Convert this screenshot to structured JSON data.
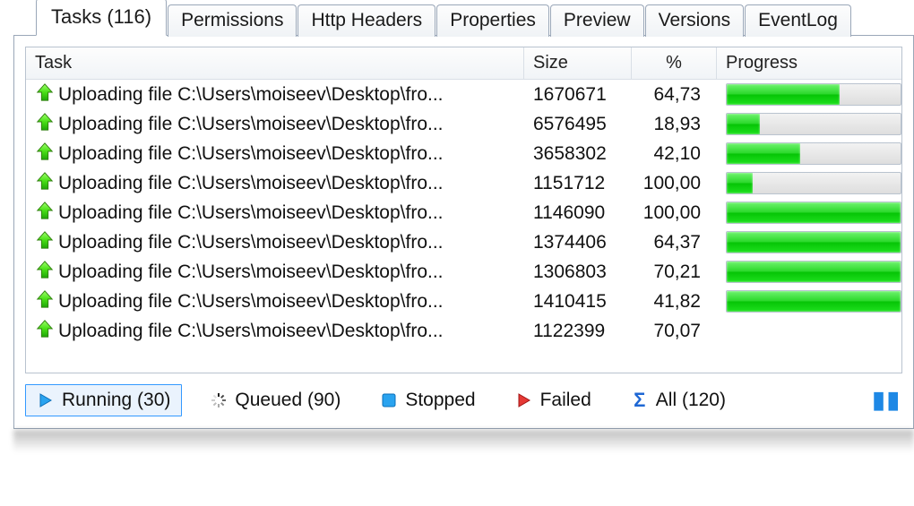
{
  "tabs": [
    {
      "key": "tasks",
      "label": "Tasks (116)",
      "active": true
    },
    {
      "key": "permissions",
      "label": "Permissions",
      "active": false
    },
    {
      "key": "http-headers",
      "label": "Http Headers",
      "active": false
    },
    {
      "key": "properties",
      "label": "Properties",
      "active": false
    },
    {
      "key": "preview",
      "label": "Preview",
      "active": false
    },
    {
      "key": "versions",
      "label": "Versions",
      "active": false
    },
    {
      "key": "eventlog",
      "label": "EventLog",
      "active": false
    }
  ],
  "columns": {
    "task": "Task",
    "size": "Size",
    "percent": "%",
    "progress": "Progress"
  },
  "rows": [
    {
      "task": "Uploading file C:\\Users\\moiseev\\Desktop\\fro...",
      "size": "1670671",
      "pct": "64,73",
      "progress": 64.73
    },
    {
      "task": "Uploading file C:\\Users\\moiseev\\Desktop\\fro...",
      "size": "6576495",
      "pct": "18,93",
      "progress": 18.93
    },
    {
      "task": "Uploading file C:\\Users\\moiseev\\Desktop\\fro...",
      "size": "3658302",
      "pct": "42,10",
      "progress": 42.1
    },
    {
      "task": "Uploading file C:\\Users\\moiseev\\Desktop\\fro...",
      "size": "1151712",
      "pct": "100,00",
      "progress": 15
    },
    {
      "task": "Uploading file C:\\Users\\moiseev\\Desktop\\fro...",
      "size": "1146090",
      "pct": "100,00",
      "progress": 100
    },
    {
      "task": "Uploading file C:\\Users\\moiseev\\Desktop\\fro...",
      "size": "1374406",
      "pct": "64,37",
      "progress": 100
    },
    {
      "task": "Uploading file C:\\Users\\moiseev\\Desktop\\fro...",
      "size": "1306803",
      "pct": "70,21",
      "progress": 100
    },
    {
      "task": "Uploading file C:\\Users\\moiseev\\Desktop\\fro...",
      "size": "1410415",
      "pct": "41,82",
      "progress": 100
    },
    {
      "task": "Uploading file C:\\Users\\moiseev\\Desktop\\fro...",
      "size": "1122399",
      "pct": "70,07",
      "progress": null
    }
  ],
  "filters": {
    "running": "Running (30)",
    "queued": "Queued (90)",
    "stopped": "Stopped",
    "failed": "Failed",
    "all": "All (120)"
  }
}
